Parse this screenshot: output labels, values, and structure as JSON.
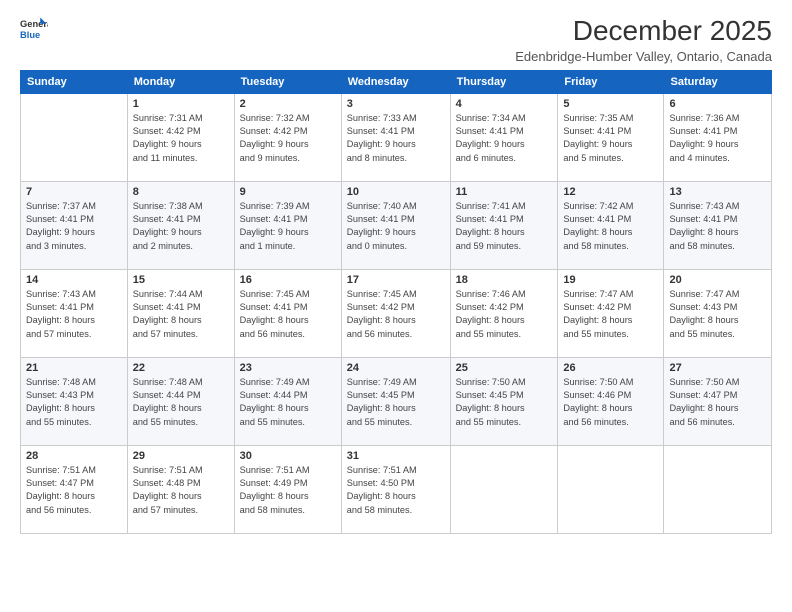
{
  "logo": {
    "line1": "General",
    "line2": "Blue"
  },
  "title": "December 2025",
  "subtitle": "Edenbridge-Humber Valley, Ontario, Canada",
  "days": [
    "Sunday",
    "Monday",
    "Tuesday",
    "Wednesday",
    "Thursday",
    "Friday",
    "Saturday"
  ],
  "weeks": [
    [
      {
        "day": "",
        "info": ""
      },
      {
        "day": "1",
        "info": "Sunrise: 7:31 AM\nSunset: 4:42 PM\nDaylight: 9 hours\nand 11 minutes."
      },
      {
        "day": "2",
        "info": "Sunrise: 7:32 AM\nSunset: 4:42 PM\nDaylight: 9 hours\nand 9 minutes."
      },
      {
        "day": "3",
        "info": "Sunrise: 7:33 AM\nSunset: 4:41 PM\nDaylight: 9 hours\nand 8 minutes."
      },
      {
        "day": "4",
        "info": "Sunrise: 7:34 AM\nSunset: 4:41 PM\nDaylight: 9 hours\nand 6 minutes."
      },
      {
        "day": "5",
        "info": "Sunrise: 7:35 AM\nSunset: 4:41 PM\nDaylight: 9 hours\nand 5 minutes."
      },
      {
        "day": "6",
        "info": "Sunrise: 7:36 AM\nSunset: 4:41 PM\nDaylight: 9 hours\nand 4 minutes."
      }
    ],
    [
      {
        "day": "7",
        "info": "Sunrise: 7:37 AM\nSunset: 4:41 PM\nDaylight: 9 hours\nand 3 minutes."
      },
      {
        "day": "8",
        "info": "Sunrise: 7:38 AM\nSunset: 4:41 PM\nDaylight: 9 hours\nand 2 minutes."
      },
      {
        "day": "9",
        "info": "Sunrise: 7:39 AM\nSunset: 4:41 PM\nDaylight: 9 hours\nand 1 minute."
      },
      {
        "day": "10",
        "info": "Sunrise: 7:40 AM\nSunset: 4:41 PM\nDaylight: 9 hours\nand 0 minutes."
      },
      {
        "day": "11",
        "info": "Sunrise: 7:41 AM\nSunset: 4:41 PM\nDaylight: 8 hours\nand 59 minutes."
      },
      {
        "day": "12",
        "info": "Sunrise: 7:42 AM\nSunset: 4:41 PM\nDaylight: 8 hours\nand 58 minutes."
      },
      {
        "day": "13",
        "info": "Sunrise: 7:43 AM\nSunset: 4:41 PM\nDaylight: 8 hours\nand 58 minutes."
      }
    ],
    [
      {
        "day": "14",
        "info": "Sunrise: 7:43 AM\nSunset: 4:41 PM\nDaylight: 8 hours\nand 57 minutes."
      },
      {
        "day": "15",
        "info": "Sunrise: 7:44 AM\nSunset: 4:41 PM\nDaylight: 8 hours\nand 57 minutes."
      },
      {
        "day": "16",
        "info": "Sunrise: 7:45 AM\nSunset: 4:41 PM\nDaylight: 8 hours\nand 56 minutes."
      },
      {
        "day": "17",
        "info": "Sunrise: 7:45 AM\nSunset: 4:42 PM\nDaylight: 8 hours\nand 56 minutes."
      },
      {
        "day": "18",
        "info": "Sunrise: 7:46 AM\nSunset: 4:42 PM\nDaylight: 8 hours\nand 55 minutes."
      },
      {
        "day": "19",
        "info": "Sunrise: 7:47 AM\nSunset: 4:42 PM\nDaylight: 8 hours\nand 55 minutes."
      },
      {
        "day": "20",
        "info": "Sunrise: 7:47 AM\nSunset: 4:43 PM\nDaylight: 8 hours\nand 55 minutes."
      }
    ],
    [
      {
        "day": "21",
        "info": "Sunrise: 7:48 AM\nSunset: 4:43 PM\nDaylight: 8 hours\nand 55 minutes."
      },
      {
        "day": "22",
        "info": "Sunrise: 7:48 AM\nSunset: 4:44 PM\nDaylight: 8 hours\nand 55 minutes."
      },
      {
        "day": "23",
        "info": "Sunrise: 7:49 AM\nSunset: 4:44 PM\nDaylight: 8 hours\nand 55 minutes."
      },
      {
        "day": "24",
        "info": "Sunrise: 7:49 AM\nSunset: 4:45 PM\nDaylight: 8 hours\nand 55 minutes."
      },
      {
        "day": "25",
        "info": "Sunrise: 7:50 AM\nSunset: 4:45 PM\nDaylight: 8 hours\nand 55 minutes."
      },
      {
        "day": "26",
        "info": "Sunrise: 7:50 AM\nSunset: 4:46 PM\nDaylight: 8 hours\nand 56 minutes."
      },
      {
        "day": "27",
        "info": "Sunrise: 7:50 AM\nSunset: 4:47 PM\nDaylight: 8 hours\nand 56 minutes."
      }
    ],
    [
      {
        "day": "28",
        "info": "Sunrise: 7:51 AM\nSunset: 4:47 PM\nDaylight: 8 hours\nand 56 minutes."
      },
      {
        "day": "29",
        "info": "Sunrise: 7:51 AM\nSunset: 4:48 PM\nDaylight: 8 hours\nand 57 minutes."
      },
      {
        "day": "30",
        "info": "Sunrise: 7:51 AM\nSunset: 4:49 PM\nDaylight: 8 hours\nand 58 minutes."
      },
      {
        "day": "31",
        "info": "Sunrise: 7:51 AM\nSunset: 4:50 PM\nDaylight: 8 hours\nand 58 minutes."
      },
      {
        "day": "",
        "info": ""
      },
      {
        "day": "",
        "info": ""
      },
      {
        "day": "",
        "info": ""
      }
    ]
  ]
}
